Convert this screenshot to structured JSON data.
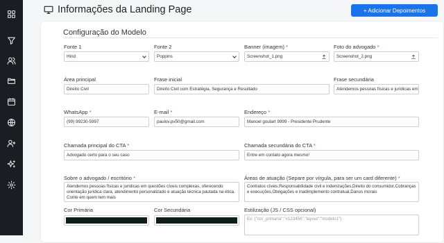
{
  "header": {
    "title": "Informações da Landing Page",
    "add_button": "+ Adicionar Depoimentos"
  },
  "section": {
    "title": "Configuração do Modelo"
  },
  "fields": {
    "fonte1": {
      "label": "Fonte 1",
      "value": "Hind"
    },
    "fonte2": {
      "label": "Fonte 2",
      "value": "Poppins"
    },
    "banner": {
      "label": "Banner (imagem)",
      "value": "Screenshot_1.png"
    },
    "foto": {
      "label": "Foto do advogado",
      "value": "Screenshot_2.png"
    },
    "area_principal": {
      "label": "Área principal",
      "value": "Direito Civil"
    },
    "frase_inicial": {
      "label": "Frase inicial",
      "value": "Direito Civil com Estratégia, Segurança e Resultado"
    },
    "frase_secundaria": {
      "label": "Frase secundária",
      "value": "Atendemos pessoas físicas e jurídicas em"
    },
    "whatsapp": {
      "label": "WhatsApp",
      "value": "(99) 99230-5997"
    },
    "email": {
      "label": "E-mail",
      "value": "paulov.pv50@gmail.com"
    },
    "endereco": {
      "label": "Endereço",
      "value": "Manoel goulart 9999 - Presidente Prudente"
    },
    "cta_principal": {
      "label": "Chamada principal do CTA",
      "value": "Advogado certo para o seu caso"
    },
    "cta_secundaria": {
      "label": "Chamada secundária do CTA",
      "value": "Entre em contato agora mesmo!"
    },
    "sobre": {
      "label": "Sobre o advogado / escritório",
      "value": "Atendemos pessoas físicas e jurídicas em questões cíveis complexas, oferecendo orientação jurídica clara, atendimento personalizado e atuação técnica pautada na ética. Conte em quem tem mais"
    },
    "areas_atuacao": {
      "label": "Áreas de atuação (Separe por vírgula, para ser um card diferente)",
      "value": "Contratos cíveis,Responsabilidade civil e indenizações,Direito do consumidor,Cobranças e execuções,Obrigações e inadimplemento contratual,Danos morais"
    },
    "cor_primaria": {
      "label": "Cor Primária",
      "color": "#0d1f17"
    },
    "cor_secundaria": {
      "label": "Cor Secundária",
      "color": "#0d1f17"
    },
    "estilizacao": {
      "label": "Estilização (JS / CSS opcional)",
      "placeholder": "Ex: {\"cor_primaria\":\"#123456\",\"layout\":\"modelo1\"}"
    }
  },
  "required_mark": "*",
  "icons": [
    "grid-icon",
    "filter-icon",
    "users-icon",
    "folder-icon",
    "calendar-icon",
    "globe-icon",
    "user-plus-icon",
    "sparkles-icon",
    "settings-icon"
  ]
}
